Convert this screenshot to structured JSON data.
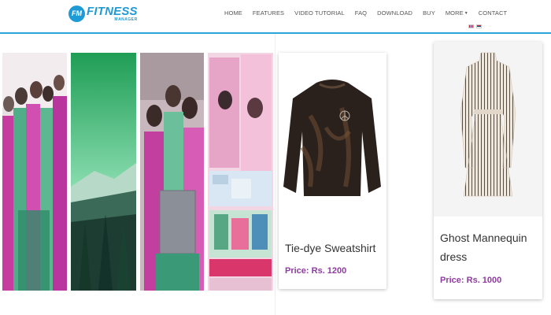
{
  "header": {
    "logo": {
      "badge": "FM",
      "title": "FITNESS",
      "subtitle": "MANAGER"
    },
    "nav": [
      {
        "label": "HOME"
      },
      {
        "label": "FEATURES"
      },
      {
        "label": "VIDEO TUTORIAL"
      },
      {
        "label": "FAQ"
      },
      {
        "label": "DOWNLOAD"
      },
      {
        "label": "BUY"
      },
      {
        "label": "MORE"
      },
      {
        "label": "CONTACT"
      }
    ],
    "languages": [
      "english-flag-icon",
      "serbian-flag-icon"
    ]
  },
  "gallery": {
    "images": [
      "group-of-people-photo",
      "mountain-forest-photo",
      "women-with-laptop-photo",
      "collage-photo"
    ]
  },
  "products": [
    {
      "title": "Tie-dye Sweatshirt",
      "price": "Price: Rs. 1200",
      "image": "sweatshirt-image"
    },
    {
      "title": "Ghost Mannequin dress",
      "price": "Price: Rs. 1000",
      "image": "striped-dress-image"
    }
  ],
  "colors": {
    "accent": "#2aa7da",
    "price": "#8e3ba0",
    "logo": "#1e9ad6"
  }
}
